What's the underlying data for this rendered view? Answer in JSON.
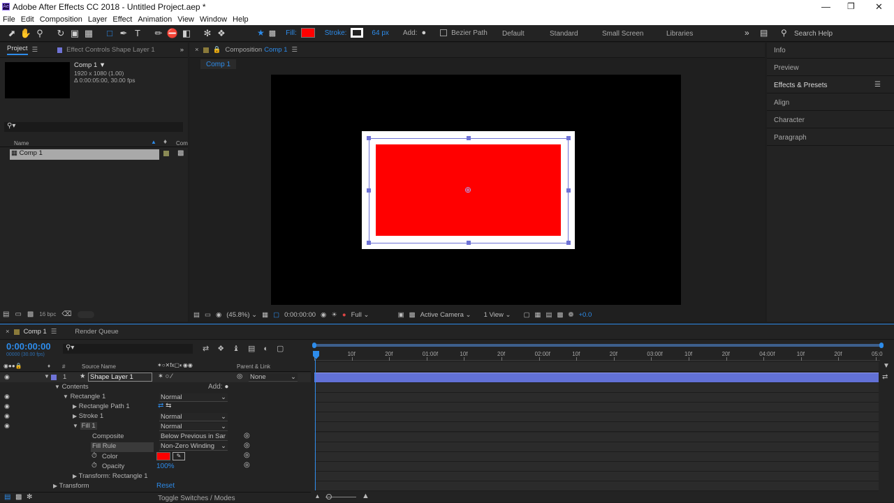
{
  "title": "Adobe After Effects CC 2018 - Untitled Project.aep *",
  "app_icon": "Ae",
  "menu": [
    "File",
    "Edit",
    "Composition",
    "Layer",
    "Effect",
    "Animation",
    "View",
    "Window",
    "Help"
  ],
  "toolbar": {
    "fill_label": "Fill:",
    "fill_color": "#ff0000",
    "stroke_label": "Stroke:",
    "stroke_width": "64 px",
    "add_label": "Add:",
    "bezier_label": "Bezier Path",
    "workspaces": [
      "Default",
      "Standard",
      "Small Screen",
      "Libraries"
    ],
    "search_placeholder": "Search Help"
  },
  "project": {
    "tab": "Project",
    "effect_tab": "Effect Controls Shape Layer 1",
    "comp_name": "Comp 1",
    "comp_res": "1920 x 1080 (1.00)",
    "comp_dur": "Δ 0:00:05:00, 30.00 fps",
    "col_name": "Name",
    "col_comment": "Com",
    "item": "Comp 1",
    "bpc": "16 bpc"
  },
  "composition": {
    "tab_prefix": "Composition",
    "tab_name": "Comp 1",
    "breadcrumb": "Comp 1",
    "zoom": "(45.8%)",
    "timecode": "0:00:00:00",
    "resolution": "Full",
    "camera": "Active Camera",
    "view": "1 View",
    "exposure": "+0.0"
  },
  "right_panels": [
    "Info",
    "Preview",
    "Effects & Presets",
    "Align",
    "Character",
    "Paragraph"
  ],
  "timeline": {
    "tab": "Comp 1",
    "render_tab": "Render Queue",
    "timecode": "0:00:00:00",
    "frame_info": "00000 (30.00 fps)",
    "col_num": "#",
    "col_source": "Source Name",
    "col_parent": "Parent & Link",
    "ruler": [
      "0f",
      "10f",
      "20f",
      "01:00f",
      "10f",
      "20f",
      "02:00f",
      "10f",
      "20f",
      "03:00f",
      "10f",
      "20f",
      "04:00f",
      "10f",
      "20f",
      "05:0"
    ],
    "layer_num": "1",
    "layer_name": "Shape Layer 1",
    "parent": "None",
    "contents": "Contents",
    "add": "Add:",
    "rect": "Rectangle 1",
    "rect_path": "Rectangle Path 1",
    "stroke": "Stroke 1",
    "fill": "Fill 1",
    "composite": "Composite",
    "fill_rule": "Fill Rule",
    "color": "Color",
    "opacity": "Opacity",
    "transform_rect": "Transform: Rectangle 1",
    "transform": "Transform",
    "normal": "Normal",
    "below_prev": "Below Previous in Sar",
    "nonzero": "Non-Zero Winding",
    "opacity_val": "100%",
    "reset": "Reset",
    "toggle": "Toggle Switches / Modes"
  }
}
